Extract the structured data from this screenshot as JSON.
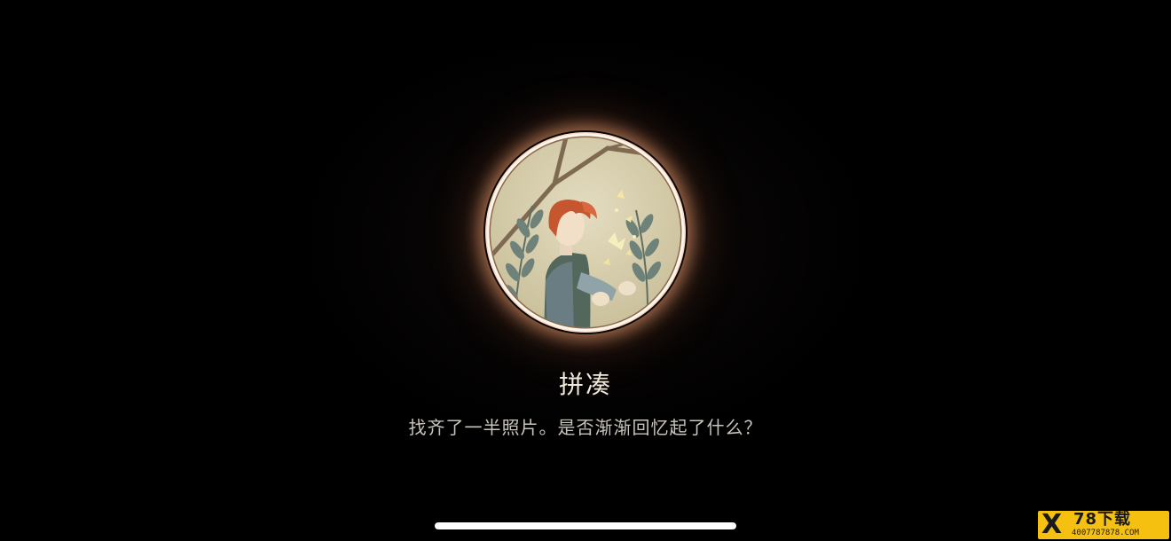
{
  "achievement": {
    "title": "拼凑",
    "description": "找齐了一半照片。是否渐渐回忆起了什么？",
    "icon": "boy-with-butterflies-badge",
    "glow_color": "#ffaa78"
  },
  "system": {
    "home_indicator": "home-indicator-bar"
  },
  "watermark": {
    "brand": "78下载",
    "url": "4007787878.COM",
    "logo": "X",
    "color": "#f5c010"
  }
}
